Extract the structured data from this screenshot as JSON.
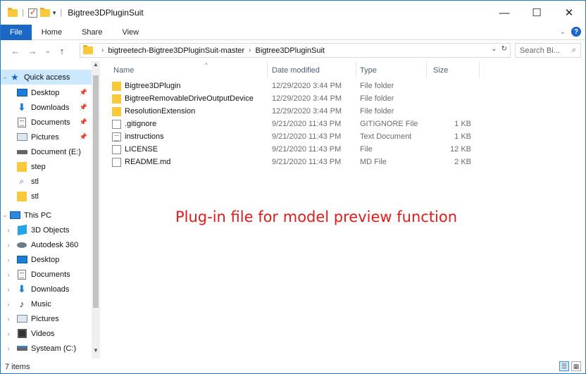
{
  "window": {
    "title": "Bigtree3DPluginSuit",
    "controls": {
      "minimize": "—",
      "maximize": "☐",
      "close": "✕"
    }
  },
  "quick_access_toolbar": {
    "separator": "|",
    "dropdown": "▾"
  },
  "ribbon": {
    "tabs": [
      {
        "label": "File"
      },
      {
        "label": "Home"
      },
      {
        "label": "Share"
      },
      {
        "label": "View"
      }
    ],
    "expand": "⌄",
    "help": "?"
  },
  "navigation": {
    "back": "←",
    "forward": "→",
    "recent": "⌄",
    "up": "↑"
  },
  "address": {
    "crumbs": [
      "bigtreetech-Bigtree3DPluginSuit-master",
      "Bigtree3DPluginSuit"
    ],
    "separator": "›",
    "dropdown": "⌄",
    "refresh": "↻"
  },
  "search": {
    "placeholder": "Search Bi...",
    "icon": "⌕"
  },
  "sidebar": {
    "quick_access": "Quick access",
    "items": [
      {
        "label": "Desktop",
        "icon": "desktop-icon",
        "pinned": true
      },
      {
        "label": "Downloads",
        "icon": "downloads-icon",
        "pinned": true
      },
      {
        "label": "Documents",
        "icon": "documents-icon",
        "pinned": true
      },
      {
        "label": "Pictures",
        "icon": "pictures-icon",
        "pinned": true
      },
      {
        "label": "Document (E:)",
        "icon": "drive-icon",
        "pinned": false
      },
      {
        "label": "step",
        "icon": "folder-icon",
        "pinned": false
      },
      {
        "label": "stl",
        "icon": "search-icon",
        "pinned": false
      },
      {
        "label": "stl",
        "icon": "folder-icon",
        "pinned": false
      }
    ],
    "this_pc": "This PC",
    "pc_items": [
      {
        "label": "3D Objects",
        "icon": "3d-objects-icon"
      },
      {
        "label": "Autodesk 360",
        "icon": "autodesk-360-icon"
      },
      {
        "label": "Desktop",
        "icon": "desktop-icon"
      },
      {
        "label": "Documents",
        "icon": "documents-icon"
      },
      {
        "label": "Downloads",
        "icon": "downloads-icon"
      },
      {
        "label": "Music",
        "icon": "music-icon"
      },
      {
        "label": "Pictures",
        "icon": "pictures-icon"
      },
      {
        "label": "Videos",
        "icon": "videos-icon"
      },
      {
        "label": "Systeam (C:)",
        "icon": "system-drive-icon"
      }
    ],
    "pin_glyph": "📌"
  },
  "columns": {
    "name": "Name",
    "date": "Date modified",
    "type": "Type",
    "size": "Size"
  },
  "files": [
    {
      "name": "Bigtree3DPlugin",
      "date": "12/29/2020 3:44 PM",
      "type": "File folder",
      "size": "",
      "kind": "folder"
    },
    {
      "name": "BigtreeRemovableDriveOutputDevice",
      "date": "12/29/2020 3:44 PM",
      "type": "File folder",
      "size": "",
      "kind": "folder"
    },
    {
      "name": "ResolutionExtension",
      "date": "12/29/2020 3:44 PM",
      "type": "File folder",
      "size": "",
      "kind": "folder"
    },
    {
      "name": ".gitignore",
      "date": "9/21/2020 11:43 PM",
      "type": "GITIGNORE File",
      "size": "1 KB",
      "kind": "file"
    },
    {
      "name": "instructions",
      "date": "9/21/2020 11:43 PM",
      "type": "Text Document",
      "size": "1 KB",
      "kind": "text"
    },
    {
      "name": "LICENSE",
      "date": "9/21/2020 11:43 PM",
      "type": "File",
      "size": "12 KB",
      "kind": "file"
    },
    {
      "name": "README.md",
      "date": "9/21/2020 11:43 PM",
      "type": "MD File",
      "size": "2 KB",
      "kind": "file"
    }
  ],
  "annotation": "Plug-in file for model preview function",
  "status": {
    "count": "7 items"
  },
  "colors": {
    "accent": "#1a67c5",
    "annotation": "#e01b1b",
    "selected": "#cce8ff",
    "folder": "#f8c93a"
  }
}
